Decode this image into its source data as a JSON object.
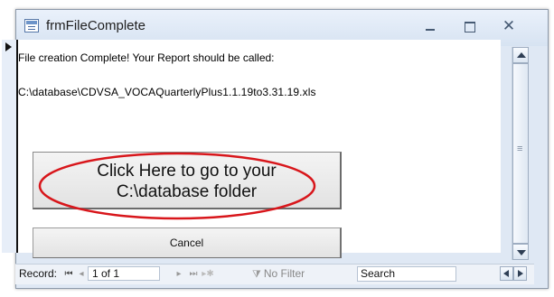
{
  "window": {
    "title": "frmFileComplete",
    "controls": {
      "minimize": "minimize-icon",
      "maximize": "maximize-icon",
      "close": "close-icon"
    }
  },
  "form": {
    "message": "File creation Complete! Your Report should be called:",
    "file_path": "C:\\database\\CDVSA_VOCAQuarterlyPlus1.1.19to3.31.19.xls",
    "go_button_line1": "Click Here to go to your",
    "go_button_line2": "C:\\database folder",
    "cancel_button": "Cancel"
  },
  "navigation": {
    "record_label": "Record:",
    "first_icon": "first-record-icon",
    "prev_icon": "previous-record-icon",
    "position": "1 of 1",
    "next_icon": "next-record-icon",
    "last_icon": "last-record-icon",
    "new_icon": "new-record-icon",
    "filter_label": "No Filter",
    "search_placeholder": "Search"
  },
  "colors": {
    "highlight_ellipse": "#d8161b",
    "window_frame": "#dfe8f4"
  }
}
